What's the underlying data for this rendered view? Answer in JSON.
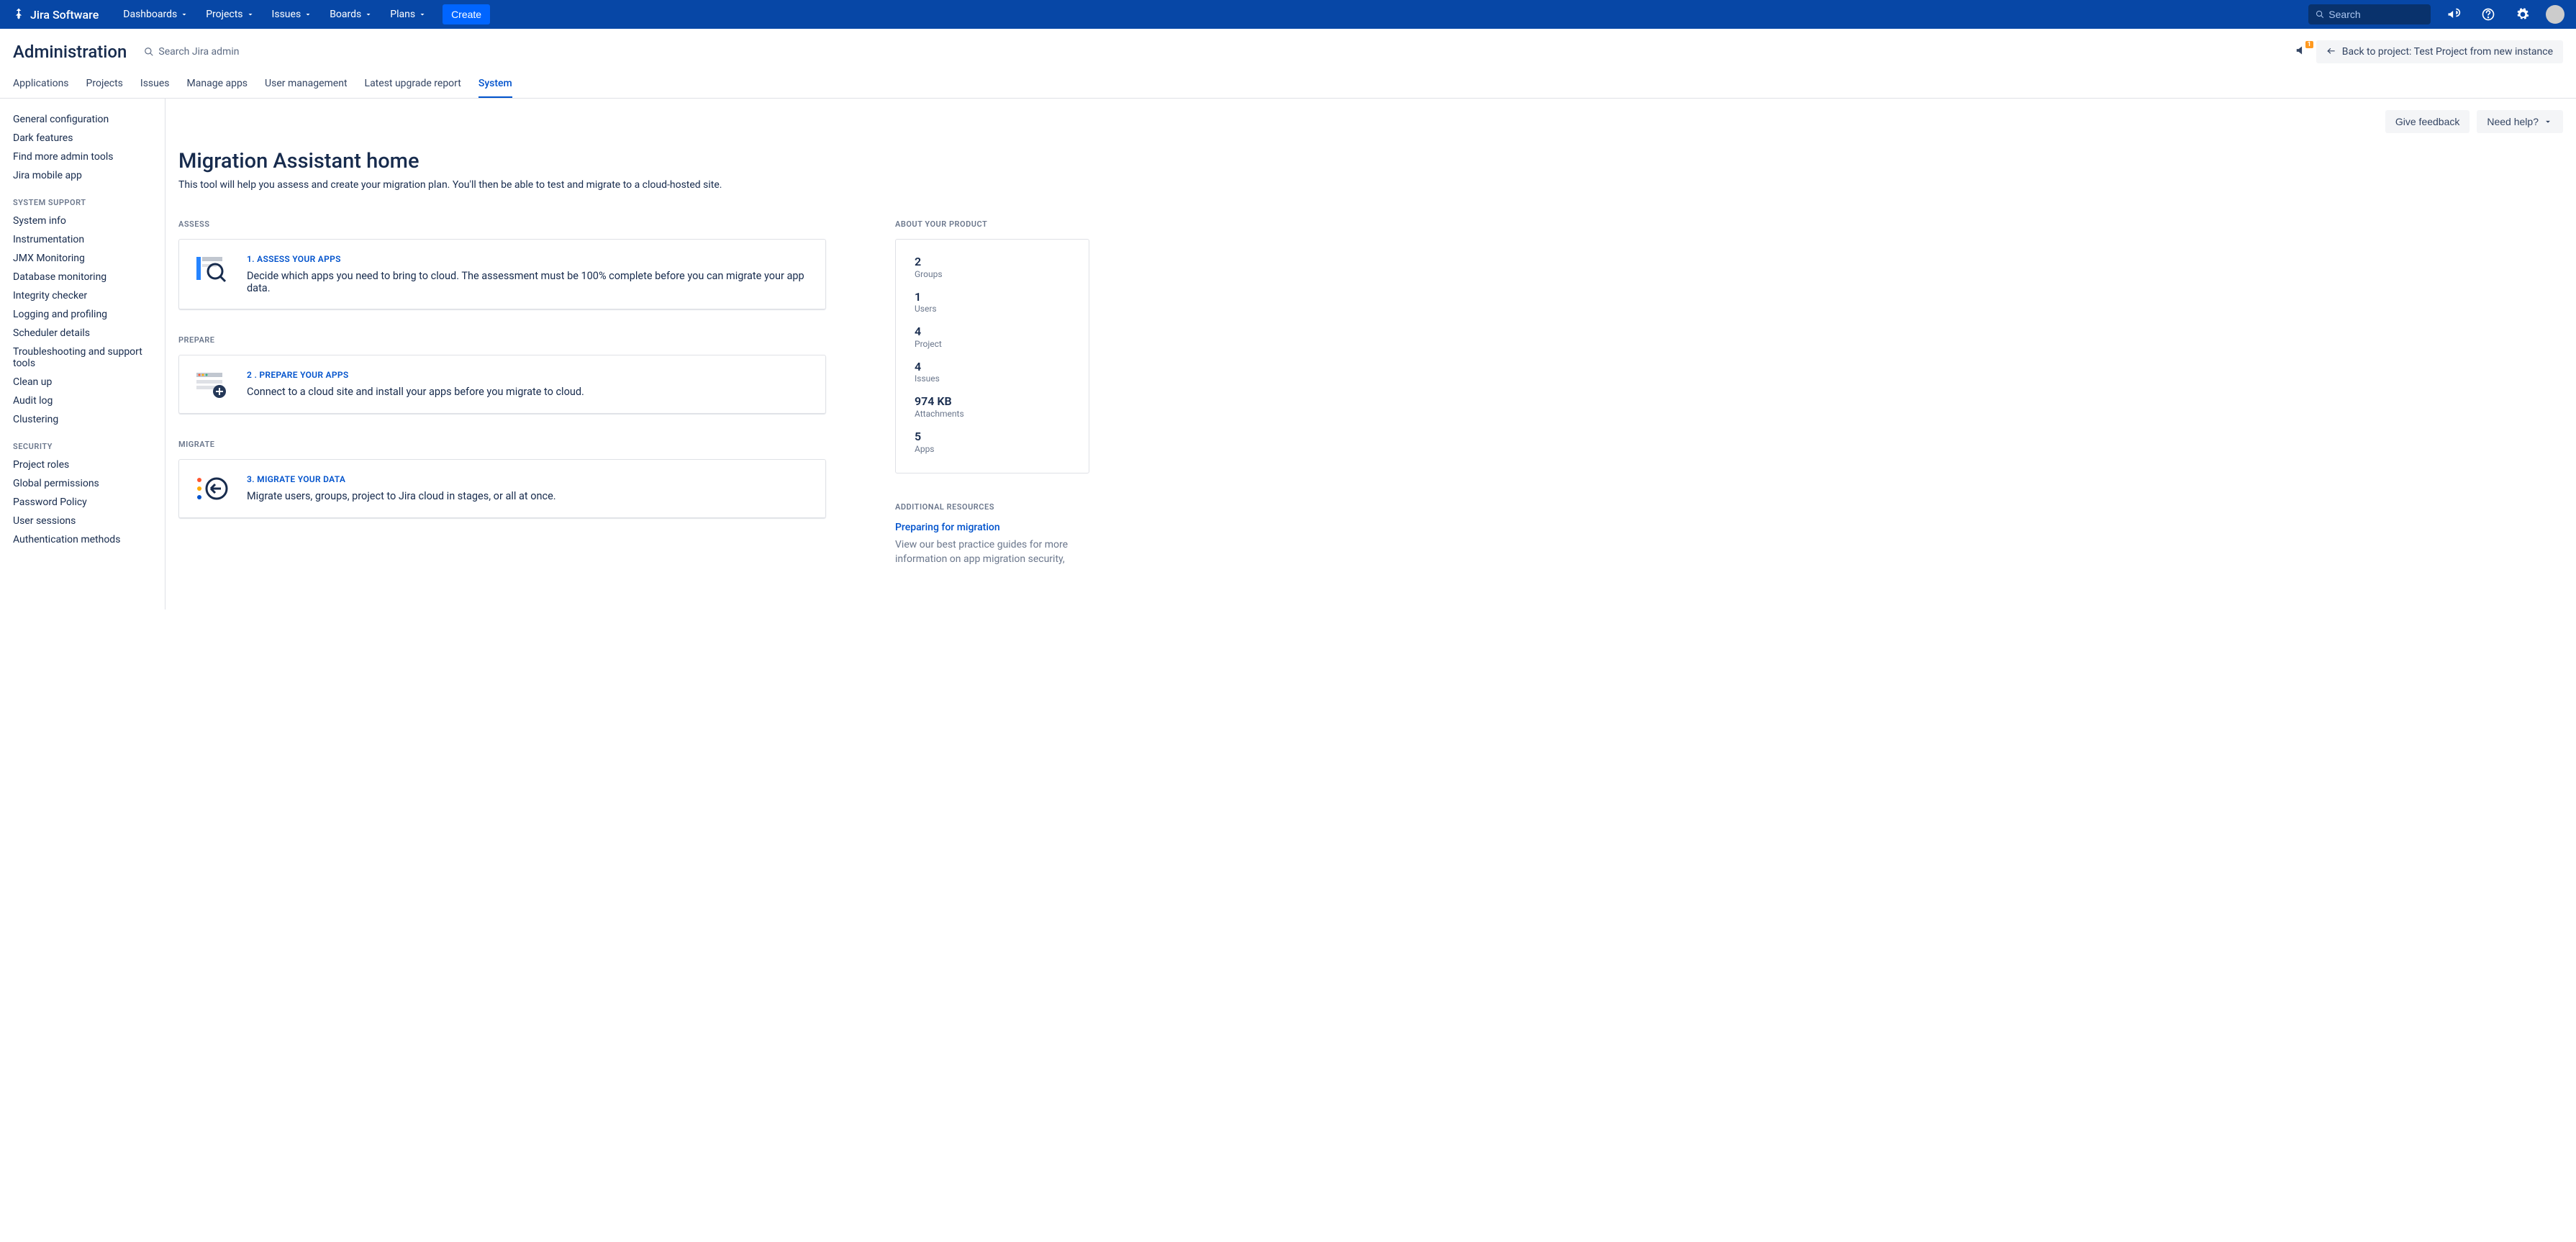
{
  "topnav": {
    "logo": "Jira Software",
    "items": [
      "Dashboards",
      "Projects",
      "Issues",
      "Boards",
      "Plans"
    ],
    "create": "Create",
    "search_placeholder": "Search"
  },
  "admin_header": {
    "title": "Administration",
    "search": "Search Jira admin",
    "feedback_badge": "1",
    "back_link": "Back to project: Test Project from new instance"
  },
  "admin_tabs": [
    "Applications",
    "Projects",
    "Issues",
    "Manage apps",
    "User management",
    "Latest upgrade report",
    "System"
  ],
  "admin_tab_active": 6,
  "sidebar": {
    "top": [
      "General configuration",
      "Dark features",
      "Find more admin tools",
      "Jira mobile app"
    ],
    "sections": [
      {
        "label": "SYSTEM SUPPORT",
        "items": [
          "System info",
          "Instrumentation",
          "JMX Monitoring",
          "Database monitoring",
          "Integrity checker",
          "Logging and profiling",
          "Scheduler details",
          "Troubleshooting and support tools",
          "Clean up",
          "Audit log",
          "Clustering"
        ]
      },
      {
        "label": "SECURITY",
        "items": [
          "Project roles",
          "Global permissions",
          "Password Policy",
          "User sessions",
          "Authentication methods"
        ]
      }
    ]
  },
  "main": {
    "give_feedback": "Give feedback",
    "need_help": "Need help?",
    "title": "Migration Assistant home",
    "subtitle": "This tool will help you assess and create your migration plan. You'll then be able to test and migrate to a cloud-hosted site.",
    "sections": [
      {
        "label": "ASSESS",
        "card": {
          "title": "1. ASSESS YOUR APPS",
          "desc": "Decide which apps you need to bring to cloud. The assessment must be 100% complete before you can migrate your app data."
        }
      },
      {
        "label": "PREPARE",
        "card": {
          "title": "2 . PREPARE YOUR APPS",
          "desc": "Connect to a cloud site and install your apps before you migrate to cloud."
        }
      },
      {
        "label": "MIGRATE",
        "card": {
          "title": "3. MIGRATE YOUR DATA",
          "desc": "Migrate users, groups, project to Jira cloud in stages, or all at once."
        }
      }
    ]
  },
  "about": {
    "label": "ABOUT YOUR PRODUCT",
    "stats": [
      {
        "val": "2",
        "label": "Groups"
      },
      {
        "val": "1",
        "label": "Users"
      },
      {
        "val": "4",
        "label": "Project"
      },
      {
        "val": "4",
        "label": "Issues"
      },
      {
        "val": "974 KB",
        "label": "Attachments"
      },
      {
        "val": "5",
        "label": "Apps"
      }
    ]
  },
  "resources": {
    "label": "ADDITIONAL RESOURCES",
    "title": "Preparing for migration",
    "desc": "View our best practice guides for more information on app migration security,"
  }
}
